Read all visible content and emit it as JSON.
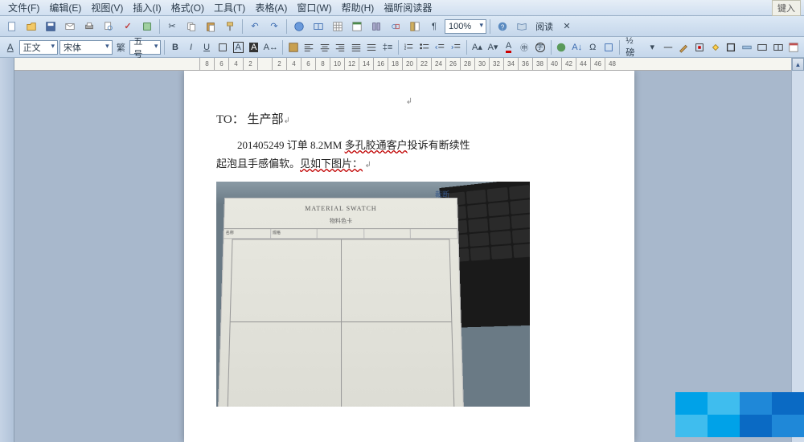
{
  "menus": [
    "文件(F)",
    "编辑(E)",
    "视图(V)",
    "插入(I)",
    "格式(O)",
    "工具(T)",
    "表格(A)",
    "窗口(W)",
    "帮助(H)",
    "福昕阅读器"
  ],
  "keyin_label": "键入",
  "toolbar1": {
    "zoom": "100%",
    "reading_label": "阅读"
  },
  "toolbar2": {
    "style": "正文",
    "font": "宋体",
    "size": "五号",
    "chinese_btn": "繁",
    "half_btn": "½ 磅"
  },
  "ruler_ticks": [
    "8",
    "6",
    "4",
    "2",
    "",
    "2",
    "4",
    "6",
    "8",
    "10",
    "12",
    "14",
    "16",
    "18",
    "20",
    "22",
    "24",
    "26",
    "28",
    "30",
    "32",
    "34",
    "36",
    "38",
    "40",
    "42",
    "44",
    "46",
    "48"
  ],
  "document": {
    "to_label": "TO：",
    "to_value": "生产部",
    "line1_prefix": "201405249 订单 8.2MM ",
    "line1_wavy": "多孔胶通客户",
    "line1_suffix": "投诉有断续性",
    "line2_plain": "起泡且手感偏软。",
    "line2_wavy": "见如下图片：",
    "photo_header": "MATERIAL SWATCH",
    "photo_sub": "物料色卡",
    "photo_annot": "裁断"
  }
}
